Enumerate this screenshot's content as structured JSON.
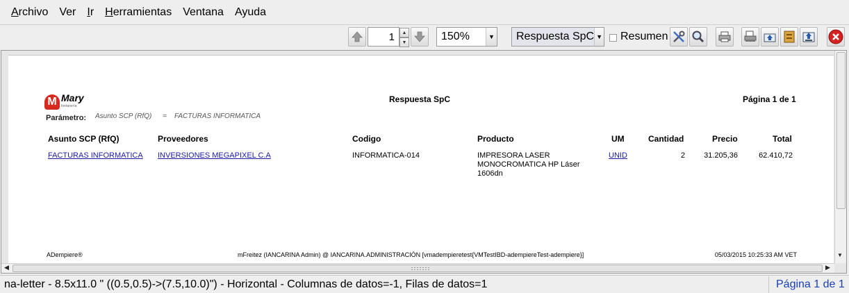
{
  "menu": {
    "items": [
      {
        "mnemonic": "A",
        "rest": "rchivo"
      },
      {
        "mnemonic": "",
        "rest": "Ver"
      },
      {
        "mnemonic": "I",
        "rest": "r"
      },
      {
        "mnemonic": "H",
        "rest": "erramientas"
      },
      {
        "mnemonic": "",
        "rest": "Ventana"
      },
      {
        "mnemonic": "",
        "rest": "Ayuda"
      }
    ]
  },
  "toolbar": {
    "page_number": "1",
    "zoom": "150%",
    "report_type": "Respuesta SpC",
    "summary_label": "Resumen",
    "icons": [
      "arrow-up-icon",
      "arrow-down-icon",
      "customize-icon",
      "find-icon",
      "print-icon",
      "print-preview-icon",
      "export-icon",
      "archive-icon",
      "save-icon",
      "close-icon"
    ]
  },
  "report": {
    "logo_text": "Mary",
    "logo_subtext": "fontanería",
    "title": "Respuesta SpC",
    "page_label": "Página 1 de 1",
    "parameter_label": "Parámetro:",
    "parameter_name": "Asunto SCP (RfQ)",
    "parameter_op": "=",
    "parameter_value": "FACTURAS INFORMATICA",
    "columns": {
      "subject": "Asunto SCP (RfQ)",
      "vendor": "Proveedores",
      "code": "Codigo",
      "product": "Producto",
      "uom": "UM",
      "quantity": "Cantidad",
      "price": "Precio",
      "total": "Total"
    },
    "rows": [
      {
        "subject": "FACTURAS INFORMATICA",
        "vendor": "INVERSIONES MEGAPIXEL  C.A",
        "code": "INFORMATICA-014",
        "product_line1": "IMPRESORA LASER",
        "product_line2": "MONOCROMATICA HP Láser",
        "product_line3": "1606dn",
        "uom": "UNID",
        "quantity": "2",
        "price": "31.205,36",
        "total": "62.410,72"
      }
    ],
    "footer": {
      "left": "ADempiere®",
      "center": "mFreitez (IANCARINA Admin) @ IANCARINA.ADMINISTRACIÓN [vmadempieretest{VMTestIBD-adempiereTest-adempiere}]",
      "right": "05/03/2015 10:25:33 AM VET"
    }
  },
  "status": {
    "text": "na-letter - 8.5x11.0 \" ((0.5,0.5)->(7.5,10.0)\") - Horizontal - Columnas de datos=-1, Filas de datos=1",
    "page": "Página 1 de 1"
  }
}
